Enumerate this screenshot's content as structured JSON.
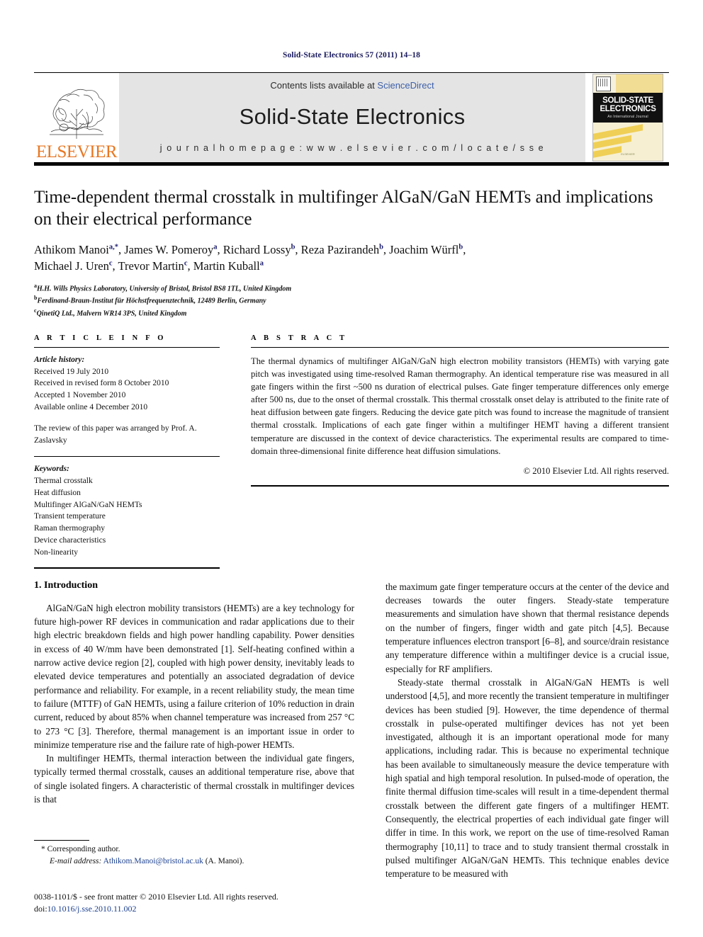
{
  "running_head": "Solid-State Electronics 57 (2011) 14–18",
  "header": {
    "publisher_name": "ELSEVIER",
    "contents_text": "Contents lists available at ",
    "sciencedirect_label": "ScienceDirect",
    "journal_name": "Solid-State Electronics",
    "homepage_text": "j o u r n a l   h o m e p a g e :   w w w . e l s e v i e r . c o m / l o c a t e / s s e",
    "cover": {
      "title_line1": "SOLID-STATE",
      "title_line2": "ELECTRONICS",
      "subtitle": "An International Journal",
      "footer_mark": "ELSEVIER"
    },
    "link_color": "#3c5fa8",
    "banner_color": "#e4e4e4",
    "brand_color": "#E87722"
  },
  "article": {
    "title": "Time-dependent thermal crosstalk in multifinger AlGaN/GaN HEMTs and implications on their electrical performance",
    "authors_line1_parts": [
      {
        "text": "Athikom Manoi",
        "sup": "a,*"
      },
      {
        "text": ", James W. Pomeroy",
        "sup": "a"
      },
      {
        "text": ", Richard Lossy",
        "sup": "b"
      },
      {
        "text": ", Reza Pazirandeh",
        "sup": "b"
      },
      {
        "text": ", Joachim Würfl",
        "sup": "b"
      },
      {
        "text": ",",
        "sup": ""
      }
    ],
    "authors_line2_parts": [
      {
        "text": "Michael J. Uren",
        "sup": "c"
      },
      {
        "text": ", Trevor Martin",
        "sup": "c"
      },
      {
        "text": ", Martin Kuball",
        "sup": "a"
      }
    ],
    "affiliations": [
      {
        "marker": "a",
        "text": "H.H. Wills Physics Laboratory, University of Bristol, Bristol BS8 1TL, United Kingdom"
      },
      {
        "marker": "b",
        "text": "Ferdinand-Braun-Institut für Höchstfrequenztechnik, 12489 Berlin, Germany"
      },
      {
        "marker": "c",
        "text": "QinetiQ Ltd., Malvern WR14 3PS, United Kingdom"
      }
    ]
  },
  "article_info": {
    "heading": "A R T I C L E   I N F O",
    "history_label": "Article history:",
    "history": [
      "Received 19 July 2010",
      "Received in revised form 8 October 2010",
      "Accepted 1 November 2010",
      "Available online 4 December 2010"
    ],
    "review_note": "The review of this paper was arranged by Prof. A. Zaslavsky",
    "keywords_label": "Keywords:",
    "keywords": [
      "Thermal crosstalk",
      "Heat diffusion",
      "Multifinger AlGaN/GaN HEMTs",
      "Transient temperature",
      "Raman thermography",
      "Device characteristics",
      "Non-linearity"
    ]
  },
  "abstract": {
    "heading": "A B S T R A C T",
    "text": "The thermal dynamics of multifinger AlGaN/GaN high electron mobility transistors (HEMTs) with varying gate pitch was investigated using time-resolved Raman thermography. An identical temperature rise was measured in all gate fingers within the first ~500 ns duration of electrical pulses. Gate finger temperature differences only emerge after 500 ns, due to the onset of thermal crosstalk. This thermal crosstalk onset delay is attributed to the finite rate of heat diffusion between gate fingers. Reducing the device gate pitch was found to increase the magnitude of transient thermal crosstalk. Implications of each gate finger within a multifinger HEMT having a different transient temperature are discussed in the context of device characteristics. The experimental results are compared to time-domain three-dimensional finite difference heat diffusion simulations.",
    "copyright": "© 2010 Elsevier Ltd. All rights reserved."
  },
  "body": {
    "section_title": "1. Introduction",
    "left_paragraphs": [
      "AlGaN/GaN high electron mobility transistors (HEMTs) are a key technology for future high-power RF devices in communication and radar applications due to their high electric breakdown fields and high power handling capability. Power densities in excess of 40 W/mm have been demonstrated [1]. Self-heating confined within a narrow active device region [2], coupled with high power density, inevitably leads to elevated device temperatures and potentially an associated degradation of device performance and reliability. For example, in a recent reliability study, the mean time to failure (MTTF) of GaN HEMTs, using a failure criterion of 10% reduction in drain current, reduced by about 85% when channel temperature was increased from 257 °C to 273 °C [3]. Therefore, thermal management is an important issue in order to minimize temperature rise and the failure rate of high-power HEMTs.",
      "In multifinger HEMTs, thermal interaction between the individual gate fingers, typically termed thermal crosstalk, causes an additional temperature rise, above that of single isolated fingers. A characteristic of thermal crosstalk in multifinger devices is that"
    ],
    "right_paragraphs": [
      "the maximum gate finger temperature occurs at the center of the device and decreases towards the outer fingers. Steady-state temperature measurements and simulation have shown that thermal resistance depends on the number of fingers, finger width and gate pitch [4,5]. Because temperature influences electron transport [6–8], and source/drain resistance any temperature difference within a multifinger device is a crucial issue, especially for RF amplifiers.",
      "Steady-state thermal crosstalk in AlGaN/GaN HEMTs is well understood [4,5], and more recently the transient temperature in multifinger devices has been studied [9]. However, the time dependence of thermal crosstalk in pulse-operated multifinger devices has not yet been investigated, although it is an important operational mode for many applications, including radar. This is because no experimental technique has been available to simultaneously measure the device temperature with high spatial and high temporal resolution. In pulsed-mode of operation, the finite thermal diffusion time-scales will result in a time-dependent thermal crosstalk between the different gate fingers of a multifinger HEMT. Consequently, the electrical properties of each individual gate finger will differ in time. In this work, we report on the use of time-resolved Raman thermography [10,11] to trace and to study transient thermal crosstalk in pulsed multifinger AlGaN/GaN HEMTs. This technique enables device temperature to be measured with"
    ]
  },
  "footnote": {
    "corresponding_marker": "*",
    "corresponding_text": "Corresponding author.",
    "email_label": "E-mail address:",
    "email": "Athikom.Manoi@bristol.ac.uk",
    "email_suffix": "(A. Manoi)."
  },
  "footer": {
    "issn_line": "0038-1101/$ - see front matter © 2010 Elsevier Ltd. All rights reserved.",
    "doi_label": "doi:",
    "doi_value": "10.1016/j.sse.2010.11.002"
  }
}
